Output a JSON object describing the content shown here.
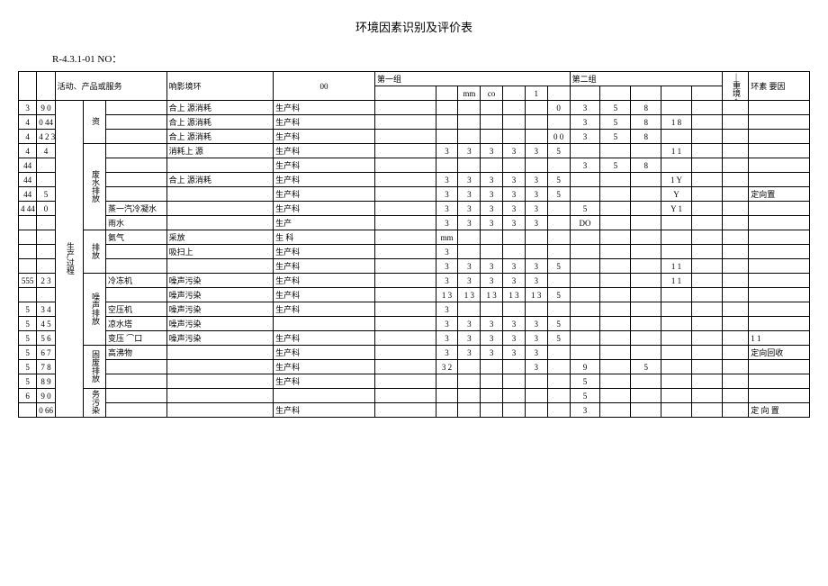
{
  "title": "环境因素识别及评价表",
  "docno": "R-4.3.1-01 NO：",
  "header": {
    "col_activity": "活动、产品或服务",
    "col_env": "响影境环",
    "col_00": "00",
    "group1": "第一组",
    "sub_mm": "mm",
    "sub_co": "co",
    "sub_1": "1",
    "group2": "第二组",
    "col_envfactor_v": "|重境1Ｖ",
    "col_envfactor_h": "环素 要因"
  },
  "leftcol": [
    "3",
    "4",
    "4",
    "4",
    "44",
    "44",
    "44",
    "4 44",
    "",
    "",
    "",
    "555",
    "",
    "5",
    "5",
    "5",
    "5",
    "5",
    "5",
    "6"
  ],
  "numcol": [
    "9 0",
    "0 44 4",
    "4 2 3",
    "4",
    "",
    "",
    "5",
    "0",
    "",
    "",
    "",
    "2 3",
    "",
    "3 4",
    "4 5",
    "5 6",
    "6 7",
    "7 8",
    "8 9",
    "9 0",
    "0 66"
  ],
  "proc_label": "生产过程",
  "cat": {
    "zi": "资",
    "wastewater": "废水排放",
    "gas": "排放",
    "noise": "噪声排放",
    "solid": "固废排放",
    "pollute": "务污染"
  },
  "rows": [
    {
      "c3": "",
      "c4": "生产科",
      "g1": [
        "",
        "",
        "",
        "",
        ""
      ],
      "g1b": "0",
      "g2": [
        "3",
        "5",
        "8",
        "",
        ""
      ],
      "last": ""
    },
    {
      "c3": "",
      "c4": "生产科",
      "g1": [
        "",
        "",
        "",
        "",
        ""
      ],
      "g1b": "",
      "g2": [
        "3",
        "5",
        "8",
        "1 8",
        ""
      ],
      "last": ""
    },
    {
      "c3": "",
      "c4": "生产科",
      "g1": [
        "",
        "",
        "",
        "",
        ""
      ],
      "g1b": "0  0",
      "g2": [
        "3",
        "5",
        "8",
        "",
        ""
      ],
      "last": ""
    },
    {
      "c3": "",
      "c4": "生产科",
      "g1": [
        "3",
        "3",
        "3",
        "3",
        "3"
      ],
      "g1b": "5",
      "g2": [
        "",
        "",
        "",
        "1 1",
        ""
      ],
      "last": ""
    },
    {
      "c3": "",
      "c4": "生产科",
      "g1": [
        "",
        "",
        "",
        "",
        ""
      ],
      "g1b": "",
      "g2": [
        "3",
        "5",
        "8",
        "",
        ""
      ],
      "last": ""
    },
    {
      "c3": "",
      "c4": "生产科",
      "g1": [
        "3",
        "3",
        "3",
        "3",
        "3"
      ],
      "g1b": "5",
      "g2": [
        "",
        "",
        "",
        "1 Y",
        ""
      ],
      "last": ""
    },
    {
      "c3": "",
      "c4": "生产科",
      "g1": [
        "3",
        "3",
        "3",
        "3",
        "3"
      ],
      "g1b": "5",
      "g2": [
        "",
        "",
        "",
        "Y",
        ""
      ],
      "last": "定向置"
    },
    {
      "c3": "蒸一汽冷凝水",
      "c4": "生产科",
      "g1": [
        "3",
        "3",
        "3",
        "3",
        "3"
      ],
      "g1b": "",
      "g2": [
        "5",
        "",
        "",
        "Y 1",
        ""
      ],
      "last": ""
    },
    {
      "c3": "雨水",
      "c4": "生产",
      "g1": [
        "3",
        "3",
        "3",
        "3",
        "3"
      ],
      "g1b": "",
      "g2": [
        "DO",
        "",
        "",
        "",
        ""
      ],
      "last": ""
    },
    {
      "c3": "氨气",
      "c4": "生 科",
      "g1": [
        "mm",
        "",
        "",
        "",
        ""
      ],
      "g1b": "",
      "g2": [
        "",
        "",
        "",
        "",
        ""
      ],
      "last": ""
    },
    {
      "c3": "",
      "c4": "生产科",
      "g1": [
        "3",
        "",
        "",
        "",
        ""
      ],
      "g1b": "",
      "g2": [
        "",
        "",
        "",
        "",
        ""
      ],
      "last": ""
    },
    {
      "c3": "",
      "c4": "生产科",
      "g1": [
        "3",
        "3",
        "3",
        "3",
        "3"
      ],
      "g1b": "5",
      "g2": [
        "",
        "",
        "",
        "1 1",
        ""
      ],
      "last": ""
    },
    {
      "c3": "冷冻机",
      "c3b": "噪声污染",
      "c4": "生产科",
      "g1": [
        "3",
        "3",
        "3",
        "3",
        "3"
      ],
      "g1b": "",
      "g2": [
        "",
        "",
        "",
        "1 1",
        ""
      ],
      "last": ""
    },
    {
      "c3": "",
      "c3b": "噪声污染",
      "c4": "生产科",
      "g1": [
        "1 3",
        "1 3",
        "1 3",
        "1 3",
        "1 3"
      ],
      "g1b": "5",
      "g2": [
        "",
        "",
        "",
        "",
        ""
      ],
      "last": ""
    },
    {
      "c3": "空压机",
      "c3b": "噪声污染",
      "c4": "生产科",
      "g1": [
        "3",
        "",
        "",
        "",
        ""
      ],
      "g1b": "",
      "g2": [
        "",
        "",
        "",
        "",
        ""
      ],
      "last": ""
    },
    {
      "c3": "凉水塔",
      "c3b": "噪声污染",
      "c4": "",
      "g1": [
        "3",
        "3",
        "3",
        "3",
        "3"
      ],
      "g1b": "5",
      "g2": [
        "",
        "",
        "",
        "",
        ""
      ],
      "last": ""
    },
    {
      "c3": "变压 ⌒口",
      "c3b": "噪声污染",
      "c4": "生产科",
      "g1": [
        "3",
        "3",
        "3",
        "3",
        "3"
      ],
      "g1b": "5",
      "g2": [
        "",
        "",
        "",
        "",
        ""
      ],
      "last": "1 1"
    },
    {
      "c3": "高沸物",
      "c4": "生产科",
      "g1": [
        "3",
        "3",
        "3",
        "3",
        "3"
      ],
      "g1b": "",
      "g2": [
        "",
        "",
        "",
        "",
        ""
      ],
      "last": "定向回收"
    },
    {
      "c3": "",
      "c4": "生产科",
      "g1": [
        "3  2",
        "",
        "",
        "",
        "3"
      ],
      "g1b": "",
      "g2": [
        "9",
        "",
        "5",
        "",
        ""
      ],
      "last": ""
    },
    {
      "c3": "",
      "c4": "生产科",
      "g1": [
        "",
        "",
        "",
        "",
        ""
      ],
      "g1b": "",
      "g2": [
        "5",
        "",
        "",
        "",
        ""
      ],
      "last": ""
    },
    {
      "c3": "",
      "c4": "",
      "g1": [
        "",
        "",
        "",
        "",
        ""
      ],
      "g1b": "",
      "g2": [
        "5",
        "",
        "",
        "",
        ""
      ],
      "last": ""
    },
    {
      "c3": "",
      "c4": "生产科",
      "g1": [
        "",
        "",
        "",
        "",
        ""
      ],
      "g1b": "",
      "g2": [
        "3",
        "",
        "",
        "",
        ""
      ],
      "last": "定 向 置"
    }
  ],
  "envcol": [
    "合上 源消耗",
    "合上 源消耗",
    "合上 源消耗",
    "消耗上  源",
    "",
    "合上 源消耗",
    "",
    "",
    "",
    "",
    "采放",
    "吸扫上",
    "",
    "",
    "",
    "",
    "",
    "",
    "",
    "",
    "",
    ""
  ],
  "chart_data": {
    "type": "table",
    "title": "环境因素识别及评价表",
    "note": "Form R-4.3.1-01; columns: 活动/产品/服务, 环境影响, 部门(生产科), 第一组评分(5 sub-columns + total), 第二组评分, 重要环境因素判定, 备注(定向置/定向回收)"
  }
}
